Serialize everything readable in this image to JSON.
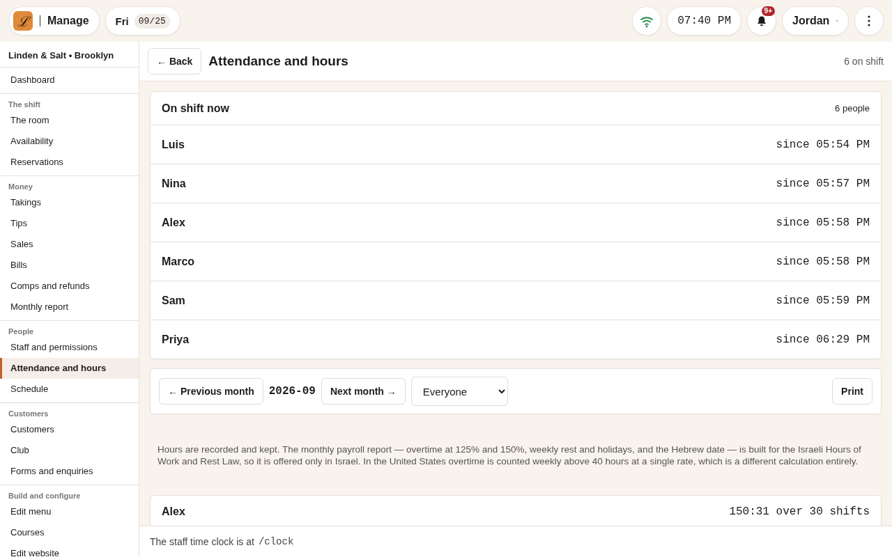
{
  "topbar": {
    "brand": {
      "logo": "ℒ",
      "label": "Manage"
    },
    "date": {
      "day": "Fri",
      "date": "09/25"
    },
    "clock": "07:40 PM",
    "notifications": {
      "badge": "9+"
    },
    "user": {
      "name": "Jordan"
    }
  },
  "sidebar": {
    "venue": "Linden & Salt • Brooklyn",
    "groups": [
      {
        "items": [
          {
            "label": "Dashboard",
            "selected": false
          }
        ]
      },
      {
        "heading": "The shift",
        "items": [
          {
            "label": "The room",
            "selected": false
          },
          {
            "label": "Availability",
            "selected": false
          },
          {
            "label": "Reservations",
            "selected": false
          }
        ]
      },
      {
        "heading": "Money",
        "items": [
          {
            "label": "Takings",
            "selected": false
          },
          {
            "label": "Tips",
            "selected": false
          },
          {
            "label": "Sales",
            "selected": false
          },
          {
            "label": "Bills",
            "selected": false
          },
          {
            "label": "Comps and refunds",
            "selected": false
          },
          {
            "label": "Monthly report",
            "selected": false
          }
        ]
      },
      {
        "heading": "People",
        "items": [
          {
            "label": "Staff and permissions",
            "selected": false
          },
          {
            "label": "Attendance and hours",
            "selected": true
          },
          {
            "label": "Schedule",
            "selected": false
          }
        ]
      },
      {
        "heading": "Customers",
        "items": [
          {
            "label": "Customers",
            "selected": false
          },
          {
            "label": "Club",
            "selected": false
          },
          {
            "label": "Forms and enquiries",
            "selected": false
          }
        ]
      },
      {
        "heading": "Build and configure",
        "items": [
          {
            "label": "Edit menu",
            "selected": false
          },
          {
            "label": "Courses",
            "selected": false
          },
          {
            "label": "Edit website",
            "selected": false
          }
        ]
      }
    ]
  },
  "header": {
    "back": "← Back",
    "title": "Attendance and hours",
    "summary": "6 on shift"
  },
  "on_shift": {
    "title": "On shift now",
    "count": "6 people",
    "rows": [
      {
        "name": "Luis",
        "since": "since 05:54 PM"
      },
      {
        "name": "Nina",
        "since": "since 05:57 PM"
      },
      {
        "name": "Alex",
        "since": "since 05:58 PM"
      },
      {
        "name": "Marco",
        "since": "since 05:58 PM"
      },
      {
        "name": "Sam",
        "since": "since 05:59 PM"
      },
      {
        "name": "Priya",
        "since": "since 06:29 PM"
      }
    ]
  },
  "toolbar": {
    "previous": "← Previous month",
    "month": "2026-09",
    "next": "Next month →",
    "filter": "Everyone",
    "print": "Print"
  },
  "note": "Hours are recorded and kept. The monthly payroll report — overtime at 125% and 150%, weekly rest and holidays, and the Hebrew date — is built for the Israeli Hours of Work and Rest Law, so it is offered only in Israel. In the United States overtime is counted weekly above 40 hours at a single rate, which is a different calculation entirely.",
  "totals": [
    {
      "name": "Alex",
      "hours": "150:31 over 30 shifts"
    }
  ],
  "footer": {
    "text": "The staff time clock is at",
    "path": "/clock"
  }
}
